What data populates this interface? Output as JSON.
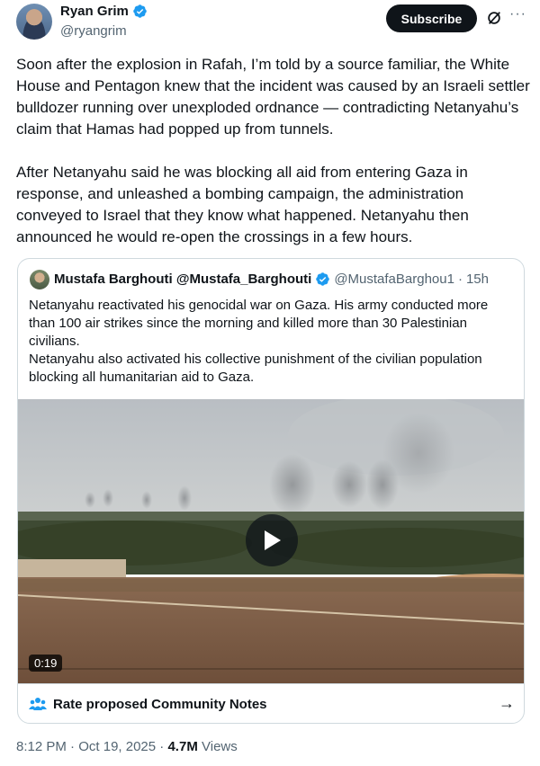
{
  "author": {
    "name": "Ryan Grim",
    "handle": "@ryangrim"
  },
  "actions": {
    "subscribe_label": "Subscribe",
    "more_label": "···"
  },
  "tweet": {
    "paragraphs": [
      "Soon after the explosion in Rafah, I’m told by a source familiar, the White House and Pentagon knew that the incident was caused by an Israeli settler bulldozer running over unexploded ordnance — contradicting Netanyahu’s claim that Hamas had popped up from tunnels.",
      "After Netanyahu said he was blocking all aid from entering Gaza in response, and unleashed a bombing campaign, the administration conveyed to Israel that they know what happened. Netanyahu then announced he would re-open the crossings in a few hours."
    ]
  },
  "quote": {
    "name": "Mustafa Barghouti @Mustafa_Barghouti",
    "handle": "@MustafaBarghou1",
    "separator": "·",
    "time": "15h",
    "lines": [
      "Netanyahu reactivated his genocidal war on Gaza. His army conducted more than 100 air strikes since the morning and killed more than 30 Palestinian civilians.",
      "Netanyahu also activated his collective punishment of the civilian population blocking all humanitarian aid to Gaza."
    ],
    "video_duration": "0:19"
  },
  "community_notes": {
    "label": "Rate proposed Community Notes",
    "arrow": "→"
  },
  "footer": {
    "time": "8:12 PM",
    "dot1": "·",
    "date": "Oct 19, 2025",
    "dot2": "·",
    "views_count": "4.7M",
    "views_label": "Views"
  },
  "colors": {
    "verified": "#1d9bf0",
    "text": "#0f1419",
    "secondary": "#536471",
    "border": "#cfd9de"
  }
}
